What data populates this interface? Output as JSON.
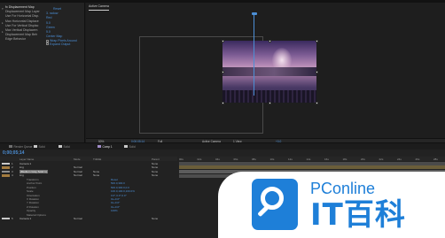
{
  "effect_controls": {
    "rows": [
      {
        "twirl": "▾",
        "label": "fx  Displacement Map",
        "value": "Reset",
        "title": true
      },
      {
        "twirl": "",
        "label": "Displacement Map Layer",
        "value": "3. radow"
      },
      {
        "twirl": "",
        "label": "Use For Horizontal Disp.",
        "value": "Red"
      },
      {
        "twirl": "▸",
        "label": "Max Horizontal Displace",
        "value": "5.0"
      },
      {
        "twirl": "",
        "label": "Use For Vertical Displac",
        "value": "Green"
      },
      {
        "twirl": "▸",
        "label": "Max Vertical Displacem",
        "value": "5.0"
      },
      {
        "twirl": "",
        "label": "Displacement Map Beh",
        "value": "Center Map"
      },
      {
        "twirl": "",
        "label": "Edge Behavior",
        "value": "Wrap Pixels Around",
        "checkbox": true
      },
      {
        "twirl": "",
        "label": "",
        "value": "Expand Output",
        "checkbox": true
      }
    ]
  },
  "composition": {
    "tab_label": "Active Camera"
  },
  "viewer_bar": {
    "zoom": "50%",
    "timecode": "0;00;05;14",
    "resolution": "Full",
    "view": "Active Camera",
    "views": "1 View",
    "offset": "+0.0"
  },
  "timeline": {
    "tabs": [
      {
        "label": "Render Queue",
        "color": "#6f6f6f",
        "active": false
      },
      {
        "label": "Solid",
        "color": "#c9c9c9",
        "active": false
      },
      {
        "label": "Solid",
        "color": "#c9c9c9",
        "active": false
      },
      {
        "label": "Comp 1",
        "color": "#a08cc8",
        "active": true
      },
      {
        "label": "Solid",
        "color": "#c9c9c9",
        "active": false
      }
    ],
    "timecode": "0;00;05;14",
    "headers": {
      "source": "Layer Name",
      "mode": "Mode",
      "trkmat": "TrkMat",
      "parent": "Parent"
    },
    "ruler_ticks": [
      "00s",
      "02s",
      "04s",
      "06s",
      "08s",
      "10s",
      "12s",
      "14s",
      "16s",
      "18s",
      "20s",
      "22s",
      "24s",
      "26s",
      "28s"
    ],
    "layers": [
      {
        "num": "1",
        "name": "Camera 1",
        "color": "#c9c9c9",
        "mode": "",
        "trk": "",
        "parent": "None",
        "bar": "#4a4a4a"
      },
      {
        "num": "2",
        "name": "img",
        "color": "#a37b3f",
        "mode": "Normal",
        "trk": "",
        "parent": "None",
        "bar": "#6b5e3a"
      },
      {
        "num": "3",
        "name": "[Medium Gray Solid 1]",
        "color": "#8e8e8e",
        "mode": "Normal",
        "trk": "None",
        "parent": "None",
        "bar": "#5c5c5c",
        "selected": true
      },
      {
        "num": "4",
        "name": "img",
        "color": "#a37b3f",
        "mode": "Normal",
        "trk": "None",
        "parent": "None",
        "bar": "#4d4d4d"
      }
    ],
    "properties": [
      {
        "name": "Transform",
        "value": "Reset",
        "value2": ""
      },
      {
        "name": "Anchor Point",
        "value": "500.0,300.0",
        "value2": ""
      },
      {
        "name": "Position",
        "value": "500.0,300.0,0.0",
        "value2": ""
      },
      {
        "name": "Scale",
        "value": "100.0,100.0,100.0%",
        "value2": ""
      },
      {
        "name": "Orientation",
        "value": "0.0°,0.0°,0.0°",
        "value2": ""
      },
      {
        "name": "X Rotation",
        "value": "0x+0.0°",
        "value2": ""
      },
      {
        "name": "Y Rotation",
        "value": "0x+0.0°",
        "value2": ""
      },
      {
        "name": "Z Rotation",
        "value": "0x+0.0°",
        "value2": ""
      },
      {
        "name": "Opacity",
        "value": "100%",
        "value2": ""
      },
      {
        "name": "Material Options",
        "value": "",
        "value2": ""
      }
    ],
    "last_layer": {
      "num": "5",
      "name": "Camera 1",
      "color": "#c9c9c9",
      "mode": "Normal",
      "parent": "None"
    }
  },
  "watermark": {
    "brand": "PConline",
    "cn": "IT百科",
    "color": "#1e7fd8"
  }
}
